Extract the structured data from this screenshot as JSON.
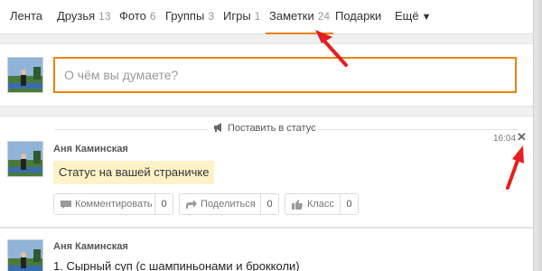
{
  "nav": {
    "items": [
      {
        "label": "Лента",
        "count": ""
      },
      {
        "label": "Друзья",
        "count": "13"
      },
      {
        "label": "Фото",
        "count": "6"
      },
      {
        "label": "Группы",
        "count": "3"
      },
      {
        "label": "Игры",
        "count": "1"
      },
      {
        "label": "Заметки",
        "count": "24"
      },
      {
        "label": "Подарки",
        "count": ""
      }
    ],
    "more_label": "Ещё"
  },
  "composer": {
    "placeholder": "О чём вы думаете?"
  },
  "status_header": {
    "label": "Поставить в статус",
    "icon": "megaphone-icon"
  },
  "posts": [
    {
      "author": "Аня Каминская",
      "time": "16:04",
      "text": "Статус на вашей страничке",
      "actions": {
        "comment": {
          "label": "Комментировать",
          "count": "0"
        },
        "share": {
          "label": "Поделиться",
          "count": "0"
        },
        "like": {
          "label": "Класс",
          "count": "0"
        }
      }
    },
    {
      "author": "Аня Каминская",
      "text": "1. Сырный суп (с шампиньонами и брокколи)"
    }
  ],
  "colors": {
    "accent": "#ee8208",
    "arrow": "#e32020",
    "status_bg": "#fdf2c8"
  }
}
